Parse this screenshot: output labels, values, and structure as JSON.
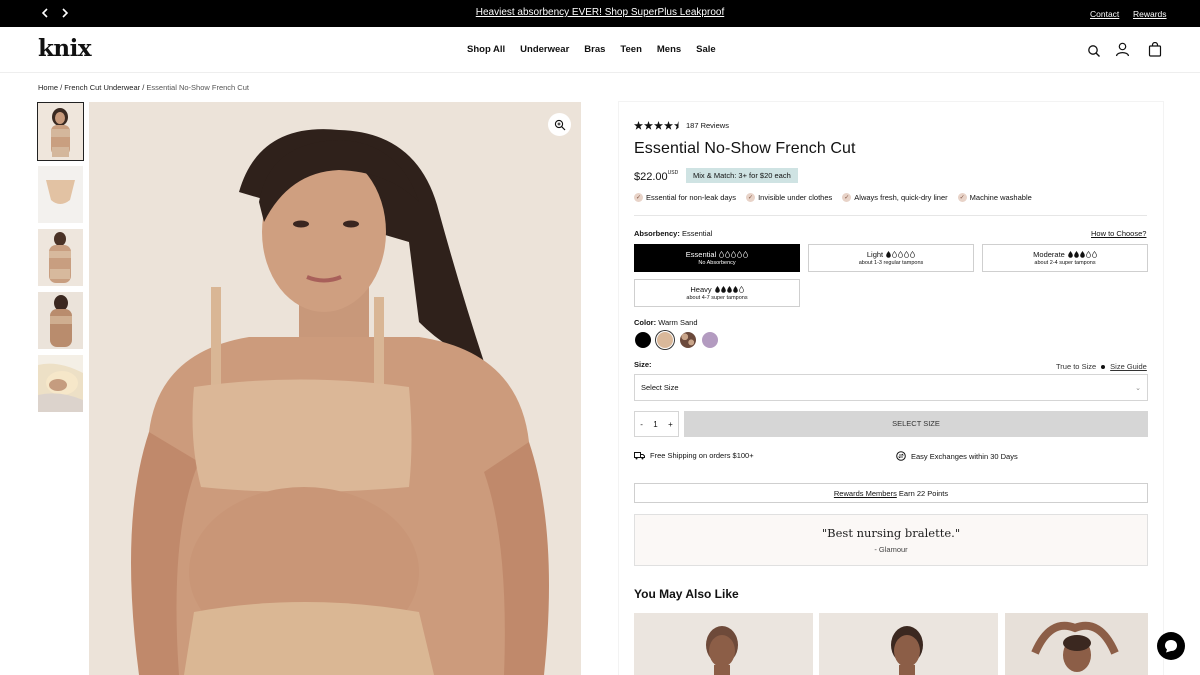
{
  "announcement": {
    "text": "Heaviest absorbency EVER! Shop SuperPlus Leakproof",
    "contact": "Contact",
    "rewards": "Rewards",
    "prev_icon": "chevron-left-icon",
    "next_icon": "chevron-right-icon"
  },
  "header": {
    "logo": "knix",
    "nav": [
      "Shop All",
      "Underwear",
      "Bras",
      "Teen",
      "Mens",
      "Sale"
    ],
    "icons": [
      "search-icon",
      "account-icon",
      "bag-icon"
    ]
  },
  "breadcrumb": {
    "home": "Home",
    "category": "French Cut Underwear",
    "current": "Essential No-Show French Cut",
    "sep": " / "
  },
  "product": {
    "rating": 4.5,
    "reviews": "187 Reviews",
    "title": "Essential No-Show French Cut",
    "price": "$22.00",
    "currency": "USD",
    "promo": "Mix & Match: 3+ for $20 each",
    "features": [
      "Essential for non-leak days",
      "Invisible under clothes",
      "Always fresh, quick-dry liner",
      "Machine washable"
    ],
    "absorbency_label": "Absorbency:",
    "absorbency_value": "Essential",
    "how_to_choose": "How to Choose?",
    "absorbency_options": [
      {
        "name": "Essential",
        "desc": "No Absorbency",
        "filled": 0,
        "selected": true
      },
      {
        "name": "Light",
        "desc": "about 1-3 regular tampons",
        "filled": 1,
        "selected": false
      },
      {
        "name": "Moderate",
        "desc": "about 2-4 super tampons",
        "filled": 3,
        "selected": false
      },
      {
        "name": "Heavy",
        "desc": "about 4-7 super tampons",
        "filled": 4,
        "selected": false
      }
    ],
    "color_label": "Color:",
    "color_value": "Warm Sand",
    "swatches": [
      "#000000",
      "#d9b89a",
      "#6b4a3c",
      "#b39bc0"
    ],
    "size_label": "Size:",
    "true_to_size": "True to Size",
    "size_guide": "Size Guide",
    "size_placeholder": "Select Size",
    "qty_minus": "-",
    "qty": "1",
    "qty_plus": "+",
    "select_button": "SELECT SIZE",
    "shipping": "Free Shipping on orders $100+",
    "exchanges": "Easy Exchanges within 30 Days",
    "rewards_link": "Rewards Members",
    "rewards_text": " Earn 22 Points",
    "quote": "\"Best nursing bralette.\"",
    "quote_source": "- Glamour",
    "you_may_also_like": "You May Also Like"
  },
  "colors": {
    "brand_black": "#000000",
    "promo_bg": "#cfe3e3",
    "skin": "#d9b89a"
  }
}
